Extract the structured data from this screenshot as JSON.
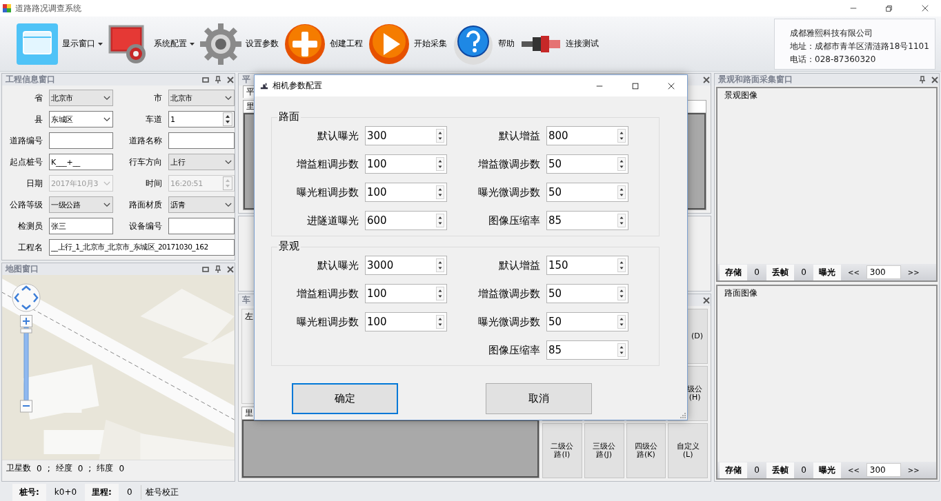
{
  "window": {
    "title": "道路路况调查系统"
  },
  "toolbar": [
    {
      "kind": "window",
      "label": "显示窗口",
      "dropdown": true
    },
    {
      "kind": "monitor",
      "label": "系统配置",
      "dropdown": true
    },
    {
      "kind": "gear",
      "label": "设置参数",
      "dropdown": false
    },
    {
      "kind": "plus",
      "label": "创建工程",
      "dropdown": false
    },
    {
      "kind": "play",
      "label": "开始采集",
      "dropdown": false
    },
    {
      "kind": "help",
      "label": "帮助",
      "dropdown": false
    },
    {
      "kind": "connector",
      "label": "连接测试",
      "dropdown": false
    }
  ],
  "company_info": [
    "成都雅熙科技有限公司",
    "地址：成都市青羊区清涟路18号1101",
    "电话：028-87360320"
  ],
  "project_panel": {
    "title": "工程信息窗口",
    "fields": [
      {
        "label": "省",
        "kind": "dropdown",
        "value": "北京市",
        "disabled": false
      },
      {
        "label": "市",
        "kind": "dropdown",
        "value": "北京市",
        "disabled": false
      },
      {
        "label": "县",
        "kind": "combo",
        "value": "东城区",
        "disabled": false
      },
      {
        "label": "车道",
        "kind": "spin",
        "value": "1",
        "disabled": false
      },
      {
        "label": "道路编号",
        "kind": "text",
        "disabled": false
      },
      {
        "label": "道路名称",
        "kind": "text",
        "disabled": false
      },
      {
        "label": "起点桩号",
        "kind": "text",
        "value": "K___+__",
        "disabled": false
      },
      {
        "label": "行车方向",
        "kind": "dropdown",
        "value": "上行",
        "disabled": false
      },
      {
        "label": "日期",
        "kind": "combo",
        "value": "2017年10月3",
        "disabled": true
      },
      {
        "label": "时间",
        "kind": "spin",
        "value": "16:20:51",
        "disabled": true
      },
      {
        "label": "公路等级",
        "kind": "dropdown",
        "value": "一级公路",
        "disabled": false
      },
      {
        "label": "路面材质",
        "kind": "dropdown",
        "value": "沥青",
        "disabled": false
      },
      {
        "label": "检测员",
        "kind": "text",
        "value": "张三",
        "disabled": false
      },
      {
        "label": "设备编号",
        "kind": "text",
        "disabled": false
      },
      {
        "label": "工程名",
        "kind": "text",
        "value": "__上行_1_北京市_北京市_东城区_20171030_162",
        "disabled": false,
        "wide": true
      }
    ]
  },
  "map_panel": {
    "title": "地图窗口",
    "status": [
      "卫星数",
      "0",
      ";",
      "经度",
      "0",
      ";",
      "纬度",
      "0"
    ]
  },
  "middle_top_panel": {
    "title": "平",
    "tab": "平",
    "column": "里"
  },
  "middle_bottom_panel": {
    "title": "车",
    "group": "左",
    "column": "里",
    "grade_buttons": [
      {
        "label": "(D)"
      },
      {
        "label": "级公(H)"
      },
      {
        "label": "二级公路(I)"
      },
      {
        "label": "三级公路(J)"
      },
      {
        "label": "四级公路(K)"
      },
      {
        "label": "自定义(L)"
      }
    ]
  },
  "capture_panel": {
    "title": "景观和路面采集窗口",
    "views": [
      {
        "title": "景观图像",
        "store_label": "存储",
        "store": "0",
        "drop_label": "丢帧",
        "drop": "0",
        "exposure_label": "曝光",
        "prev": "<<",
        "exposure": "300",
        "next": ">>"
      },
      {
        "title": "路面图像",
        "store_label": "存储",
        "store": "0",
        "drop_label": "丢帧",
        "drop": "0",
        "exposure_label": "曝光",
        "prev": "<<",
        "exposure": "300",
        "next": ">>"
      }
    ]
  },
  "dialog": {
    "title": "相机参数配置",
    "groups": [
      {
        "title": "路面",
        "rows": [
          {
            "left": {
              "label": "默认曝光",
              "value": "300"
            },
            "right": {
              "label": "默认增益",
              "value": "800"
            }
          },
          {
            "left": {
              "label": "增益粗调步数",
              "value": "100"
            },
            "right": {
              "label": "增益微调步数",
              "value": "50"
            }
          },
          {
            "left": {
              "label": "曝光粗调步数",
              "value": "100"
            },
            "right": {
              "label": "曝光微调步数",
              "value": "50"
            }
          },
          {
            "left": {
              "label": "进隧道曝光",
              "value": "600"
            },
            "right": {
              "label": "图像压缩率",
              "value": "85"
            }
          }
        ]
      },
      {
        "title": "景观",
        "rows": [
          {
            "left": {
              "label": "默认曝光",
              "value": "3000"
            },
            "right": {
              "label": "默认增益",
              "value": "150"
            }
          },
          {
            "left": {
              "label": "增益粗调步数",
              "value": "100"
            },
            "right": {
              "label": "增益微调步数",
              "value": "50"
            }
          },
          {
            "left": {
              "label": "曝光粗调步数",
              "value": "100"
            },
            "right": {
              "label": "曝光微调步数",
              "value": "50"
            }
          },
          {
            "right": {
              "label": "图像压缩率",
              "value": "85"
            }
          }
        ]
      }
    ],
    "buttons": [
      {
        "label": "确定",
        "focused": true
      },
      {
        "label": "取消",
        "focused": false
      }
    ]
  },
  "status_bar": {
    "stake_label": "桩号:",
    "stake": "k0+0",
    "mileage_label": "里程:",
    "mileage": "0",
    "calibrate": "桩号校正"
  }
}
